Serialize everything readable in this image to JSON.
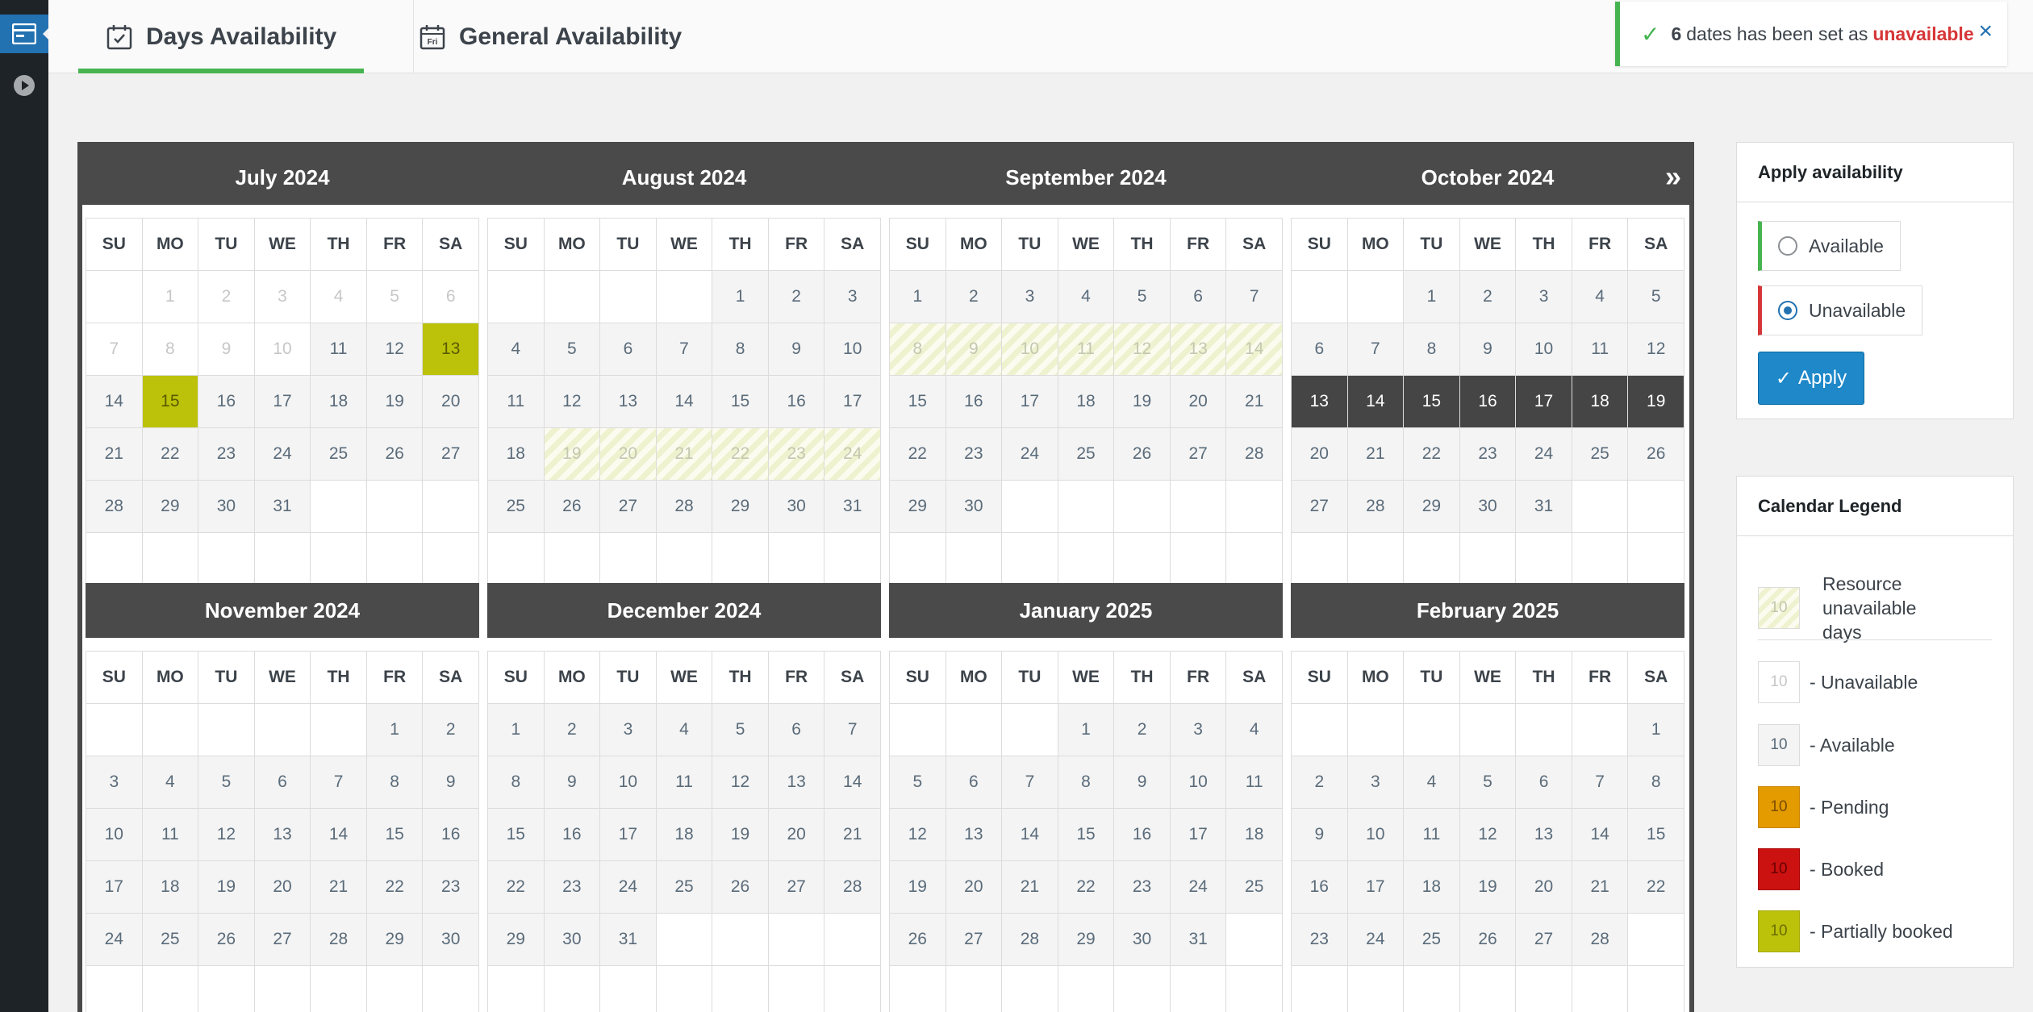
{
  "sidebar": {
    "items": [
      {
        "icon": "calendar-app-icon",
        "active": true
      },
      {
        "icon": "play-circle-icon",
        "active": false
      }
    ]
  },
  "tabs": [
    {
      "label": "Days Availability",
      "icon": "calendar-check-icon",
      "active": true
    },
    {
      "label": "General Availability",
      "icon": "calendar-fri-icon",
      "active": false,
      "icon_text": "Fri"
    }
  ],
  "notice": {
    "count": "6",
    "text": "dates has been set as",
    "status": "unavailable",
    "close": "×"
  },
  "calendar": {
    "next": "»",
    "weekdays": [
      "SU",
      "MO",
      "TU",
      "WE",
      "TH",
      "FR",
      "SA"
    ],
    "months": [
      {
        "title": "July 2024",
        "start": 1,
        "days": 31,
        "past": [
          1,
          2,
          3,
          4,
          5,
          6,
          7,
          8,
          9,
          10
        ],
        "resource": [],
        "partial": [
          13,
          15
        ],
        "selected": [],
        "unavailable": []
      },
      {
        "title": "August 2024",
        "start": 4,
        "days": 31,
        "past": [],
        "resource": [
          19,
          20,
          21,
          22,
          23,
          24
        ],
        "partial": [],
        "selected": [],
        "unavailable": []
      },
      {
        "title": "September 2024",
        "start": 0,
        "days": 30,
        "past": [],
        "resource": [
          8,
          9,
          10,
          11,
          12,
          13,
          14
        ],
        "partial": [],
        "selected": [],
        "unavailable": []
      },
      {
        "title": "October 2024",
        "start": 2,
        "days": 31,
        "past": [],
        "resource": [],
        "partial": [],
        "selected": [
          13,
          14,
          15,
          16,
          17,
          18,
          19
        ],
        "unavailable": []
      },
      {
        "title": "November 2024",
        "start": 5,
        "days": 30,
        "past": [],
        "resource": [],
        "partial": [],
        "selected": [],
        "unavailable": []
      },
      {
        "title": "December 2024",
        "start": 0,
        "days": 31,
        "past": [],
        "resource": [],
        "partial": [],
        "selected": [],
        "unavailable": []
      },
      {
        "title": "January 2025",
        "start": 3,
        "days": 31,
        "past": [],
        "resource": [],
        "partial": [],
        "selected": [],
        "unavailable": []
      },
      {
        "title": "February 2025",
        "start": 6,
        "days": 28,
        "past": [],
        "resource": [],
        "partial": [],
        "selected": [],
        "unavailable": []
      }
    ]
  },
  "apply": {
    "title": "Apply availability",
    "options": [
      {
        "label": "Available",
        "checked": false,
        "color": "#46b450"
      },
      {
        "label": "Unavailable",
        "checked": true,
        "color": "#d63638"
      }
    ],
    "button": "Apply"
  },
  "legend": {
    "title": "Calendar Legend",
    "sample_day": "10",
    "items": [
      {
        "label": "Resource unavailable days",
        "type": "resource"
      },
      {
        "label": "- Unavailable",
        "type": "unavailable"
      },
      {
        "label": "- Available",
        "type": "available"
      },
      {
        "label": "- Pending",
        "type": "pending",
        "color": "#e39b00"
      },
      {
        "label": "- Booked",
        "type": "booked",
        "color": "#cc1111"
      },
      {
        "label": "- Partially booked",
        "type": "partial",
        "color": "#bcc20a"
      }
    ]
  }
}
